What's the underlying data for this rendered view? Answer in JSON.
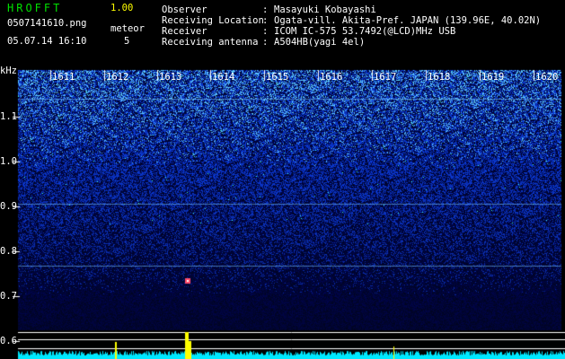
{
  "header": {
    "app_name": "HROFFT",
    "version": "1.00",
    "filename": "0507141610.png",
    "datetime": "05.07.14 16:10",
    "meteor_label": "meteor",
    "meteor_count": "5",
    "info": [
      {
        "key": "Observer",
        "sep": ":",
        "value": "Masayuki Kobayashi"
      },
      {
        "key": "Receiving Location",
        "sep": ":",
        "value": "Ogata-vill. Akita-Pref. JAPAN (139.96E, 40.02N)"
      },
      {
        "key": "Receiver",
        "sep": ":",
        "value": "ICOM IC-575 53.7492(@LCD)MHz USB"
      },
      {
        "key": "Receiving antenna",
        "sep": ":",
        "value": "A504HB(yagi 4el)"
      }
    ]
  },
  "spectrogram": {
    "unit": "kHz",
    "time_labels": [
      "1611",
      "1612",
      "1613",
      "1614",
      "1615",
      "1616",
      "1617",
      "1618",
      "1619",
      "1620"
    ],
    "freq_labels": [
      "1.1",
      "1.0",
      "0.9",
      "0.8",
      "0.7",
      "0.6"
    ],
    "colors": {
      "background": "#000000",
      "noise_dark": "#000a5a",
      "noise_bright": "#2a4cff",
      "echo": "#ff4a6a",
      "spectrum_line": "#00e8ff",
      "peak": "#ffff00",
      "tick": "#ffffff"
    }
  }
}
